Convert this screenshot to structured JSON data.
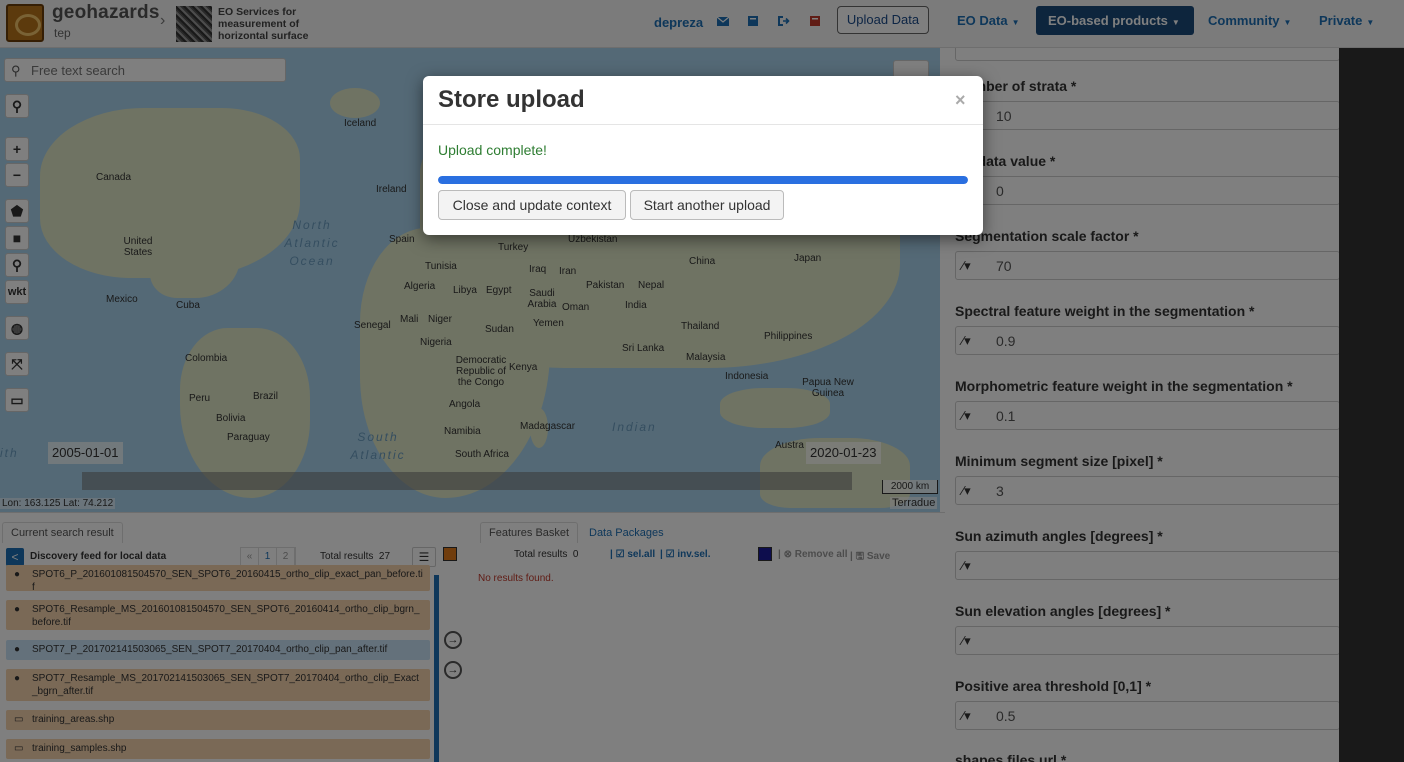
{
  "navbar": {
    "brand_name": "geohazards",
    "brand_sub": "tep",
    "context_title": "EO Services for measurement of horizontal surface",
    "username": "depreza",
    "upload_button": "Upload Data",
    "menu": [
      {
        "label": "EO Data"
      },
      {
        "label": "EO-based products"
      },
      {
        "label": "Community"
      },
      {
        "label": "Private"
      }
    ]
  },
  "map": {
    "search_placeholder": "Free text search",
    "tool_wkt": "wkt",
    "start_date": "2005-01-01",
    "end_date": "2020-01-23",
    "scale": "2000 km",
    "coords": "Lon: 163.125 Lat: 74.212",
    "attribution": "Terradue",
    "labels": {
      "iceland": "Iceland",
      "ireland": "Ireland",
      "canada": "Canada",
      "us": "United States",
      "mexico": "Mexico",
      "cuba": "Cuba",
      "colombia": "Colombia",
      "peru": "Peru",
      "brazil": "Brazil",
      "bolivia": "Bolivia",
      "paraguay": "Paraguay",
      "spain": "Spain",
      "tunisia": "Tunisia",
      "algeria": "Algeria",
      "libya": "Libya",
      "egypt": "Egypt",
      "mali": "Mali",
      "niger": "Niger",
      "senegal": "Senegal",
      "nigeria": "Nigeria",
      "sudan": "Sudan",
      "drc": "Democratic Republic of the Congo",
      "kenya": "Kenya",
      "angola": "Angola",
      "namibia": "Namibia",
      "madagascar": "Madagascar",
      "south_africa": "South Africa",
      "turkey": "Turkey",
      "iraq": "Iraq",
      "iran": "Iran",
      "saudi": "Saudi Arabia",
      "yemen": "Yemen",
      "oman": "Oman",
      "pakistan": "Pakistan",
      "india": "India",
      "nepal": "Nepal",
      "uzbekistan": "Uzbekistan",
      "china": "China",
      "japan": "Japan",
      "thailand": "Thailand",
      "philippines": "Philippines",
      "sri_lanka": "Sri Lanka",
      "malaysia": "Malaysia",
      "indonesia": "Indonesia",
      "png": "Papua New Guinea",
      "australia": "Austra",
      "north_atlantic": "North Atlantic Ocean",
      "south_atlantic": "South Atlantic",
      "indian": "Indian",
      "ocean_left": "ith"
    }
  },
  "results": {
    "tab_label": "Current search result",
    "feed_title": "Discovery feed for local data",
    "pager": [
      "«",
      "1",
      "2"
    ],
    "total_label": "Total results",
    "total_value": "27",
    "items": [
      "SPOT6_P_201601081504570_SEN_SPOT6_20160415_ortho_clip_exact_pan_before.tif",
      "SPOT6_Resample_MS_201601081504570_SEN_SPOT6_20160414_ortho_clip_bgrn_before.tif",
      "SPOT7_P_201702141503065_SEN_SPOT7_20170404_ortho_clip_pan_after.tif",
      "SPOT7_Resample_MS_201702141503065_SEN_SPOT7_20170404_ortho_clip_Exact_bgrn_after.tif",
      "training_areas.shp",
      "training_samples.shp"
    ]
  },
  "basket": {
    "tab_features": "Features Basket",
    "tab_packages": "Data Packages",
    "total_label": "Total results",
    "total_value": "0",
    "sel_all": "sel.all",
    "inv_sel": "inv.sel.",
    "remove_all": "Remove all",
    "save": "Save",
    "no_results": "No results found."
  },
  "form": {
    "fields": [
      {
        "label": "Number of strata *",
        "value": "10"
      },
      {
        "label": "No data value *",
        "value": "0"
      },
      {
        "label": "Segmentation scale factor *",
        "value": "70"
      },
      {
        "label": "Spectral feature weight in the segmentation *",
        "value": "0.9"
      },
      {
        "label": "Morphometric feature weight in the segmentation *",
        "value": "0.1"
      },
      {
        "label": "Minimum segment size [pixel] *",
        "value": "3"
      },
      {
        "label": "Sun azimuth angles [degrees] *",
        "value": ""
      },
      {
        "label": "Sun elevation angles [degrees] *",
        "value": ""
      },
      {
        "label": "Positive area threshold [0,1] *",
        "value": "0.5"
      },
      {
        "label": "shapes files url *",
        "value": ""
      }
    ]
  },
  "modal": {
    "title": "Store upload",
    "close": "×",
    "status": "Upload complete!",
    "progress": 1.0,
    "btn_close_update": "Close and update context",
    "btn_another": "Start another upload"
  }
}
